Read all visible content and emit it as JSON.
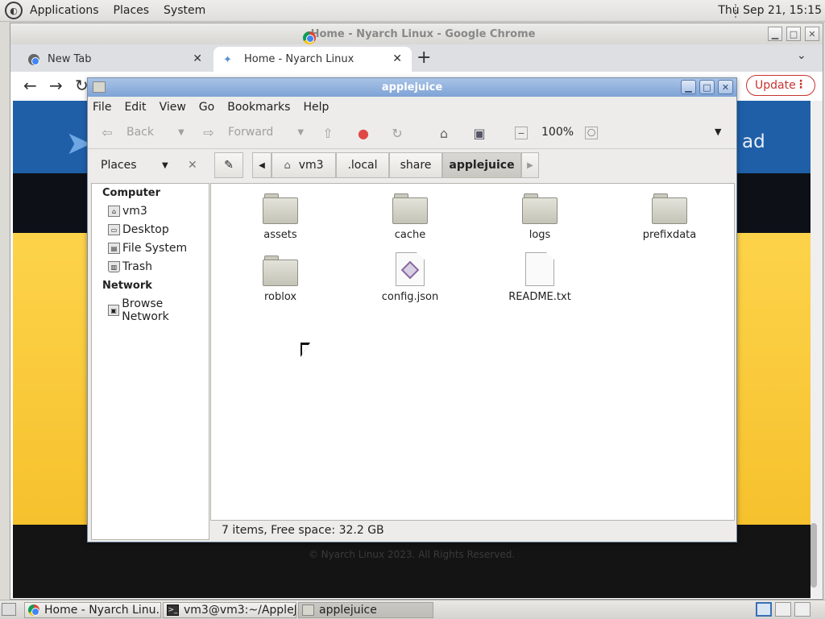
{
  "top_panel": {
    "menu": [
      "Applications",
      "Places",
      "System"
    ],
    "clock": "Thu Sep 21, 15:15"
  },
  "chrome": {
    "title": "Home - Nyarch Linux - Google Chrome",
    "tabs": [
      {
        "label": "New Tab"
      },
      {
        "label": "Home - Nyarch Linux"
      }
    ],
    "new_tab_symbol": "+",
    "update_label": "Update",
    "page": {
      "banner_text": "ad",
      "footer": "© Nyarch Linux 2023. All Rights Reserved."
    }
  },
  "file_manager": {
    "title": "applejuice",
    "menu": [
      "File",
      "Edit",
      "View",
      "Go",
      "Bookmarks",
      "Help"
    ],
    "toolbar": {
      "back": "Back",
      "forward": "Forward",
      "zoom": "100%"
    },
    "places_label": "Places",
    "breadcrumbs": [
      "vm3",
      ".local",
      "share",
      "applejuice"
    ],
    "sidebar": {
      "computer_header": "Computer",
      "computer_items": [
        "vm3",
        "Desktop",
        "File System",
        "Trash"
      ],
      "network_header": "Network",
      "network_items": [
        "Browse Network"
      ]
    },
    "items": [
      {
        "name": "assets",
        "kind": "folder"
      },
      {
        "name": "cache",
        "kind": "folder"
      },
      {
        "name": "logs",
        "kind": "folder"
      },
      {
        "name": "prefixdata",
        "kind": "folder"
      },
      {
        "name": "roblox",
        "kind": "folder"
      },
      {
        "name": "config.json",
        "kind": "json"
      },
      {
        "name": "README.txt",
        "kind": "text"
      }
    ],
    "status": "7 items, Free space: 32.2 GB"
  },
  "taskbar": {
    "tasks": [
      {
        "label": "Home - Nyarch Linu...",
        "icon": "chrome-icon"
      },
      {
        "label": "vm3@vm3:~/AppleJ...",
        "icon": "terminal-icon"
      },
      {
        "label": "applejuice",
        "icon": "folder-icon"
      }
    ]
  },
  "colors": {
    "accent_blue": "#1f5fa8",
    "banner_yellow": "#fdd34a",
    "update_red": "#c6332f",
    "fm_titlebar": "#7ea3d6"
  }
}
